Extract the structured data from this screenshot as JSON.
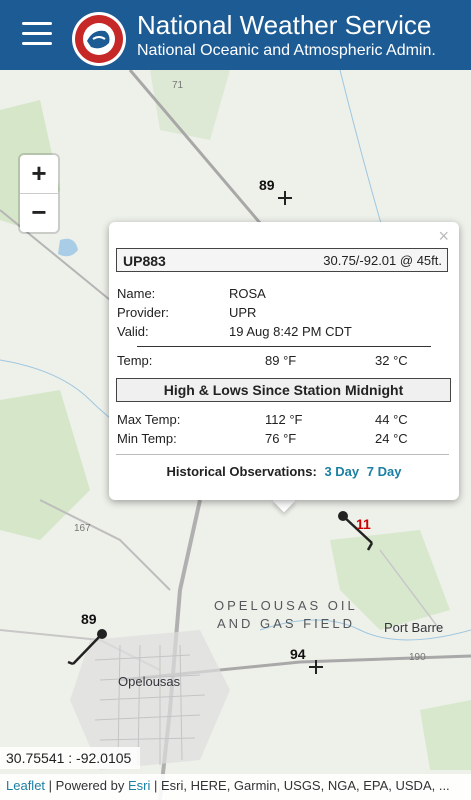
{
  "header": {
    "title": "National Weather Service",
    "subtitle": "National Oceanic and Atmospheric Admin.",
    "logo_text": "NATIONAL WEATHER SERVICE"
  },
  "zoom": {
    "in_label": "+",
    "out_label": "−"
  },
  "map": {
    "stations": [
      {
        "value": "89"
      },
      {
        "value": "11"
      },
      {
        "value": "89"
      },
      {
        "value": "94"
      }
    ],
    "labels": {
      "oil_field_1": "OPELOUSAS OIL",
      "oil_field_2": "AND GAS FIELD",
      "port_barre": "Port Barre",
      "opelousas": "Opelousas",
      "road_71": "71",
      "road_167": "167",
      "road_190": "190"
    }
  },
  "popup": {
    "close_label": "×",
    "station_id": "UP883",
    "location": "30.75/-92.01 @ 45ft.",
    "name_label": "Name:",
    "name_value": "ROSA",
    "provider_label": "Provider:",
    "provider_value": "UPR",
    "valid_label": "Valid:",
    "valid_value": "19 Aug 8:42 PM CDT",
    "temp_label": "Temp:",
    "temp_f": "89 °F",
    "temp_c": "32 °C",
    "hilo_title": "High & Lows Since Station Midnight",
    "max_label": "Max Temp:",
    "max_f": "112 °F",
    "max_c": "44 °C",
    "min_label": "Min Temp:",
    "min_f": "76 °F",
    "min_c": "24 °C",
    "hist_label": "Historical Observations:",
    "hist_3day": "3 Day",
    "hist_7day": "7 Day"
  },
  "footer": {
    "coords": "30.75541 : -92.0105",
    "leaflet": "Leaflet",
    "powered_by": "Powered by",
    "esri": "Esri",
    "credits": "Esri, HERE, Garmin, USGS, NGA, EPA, USDA, ..."
  },
  "colors": {
    "header_bg": "#1d5b94",
    "link": "#1b7fa3",
    "station_red": "#cc0000"
  }
}
